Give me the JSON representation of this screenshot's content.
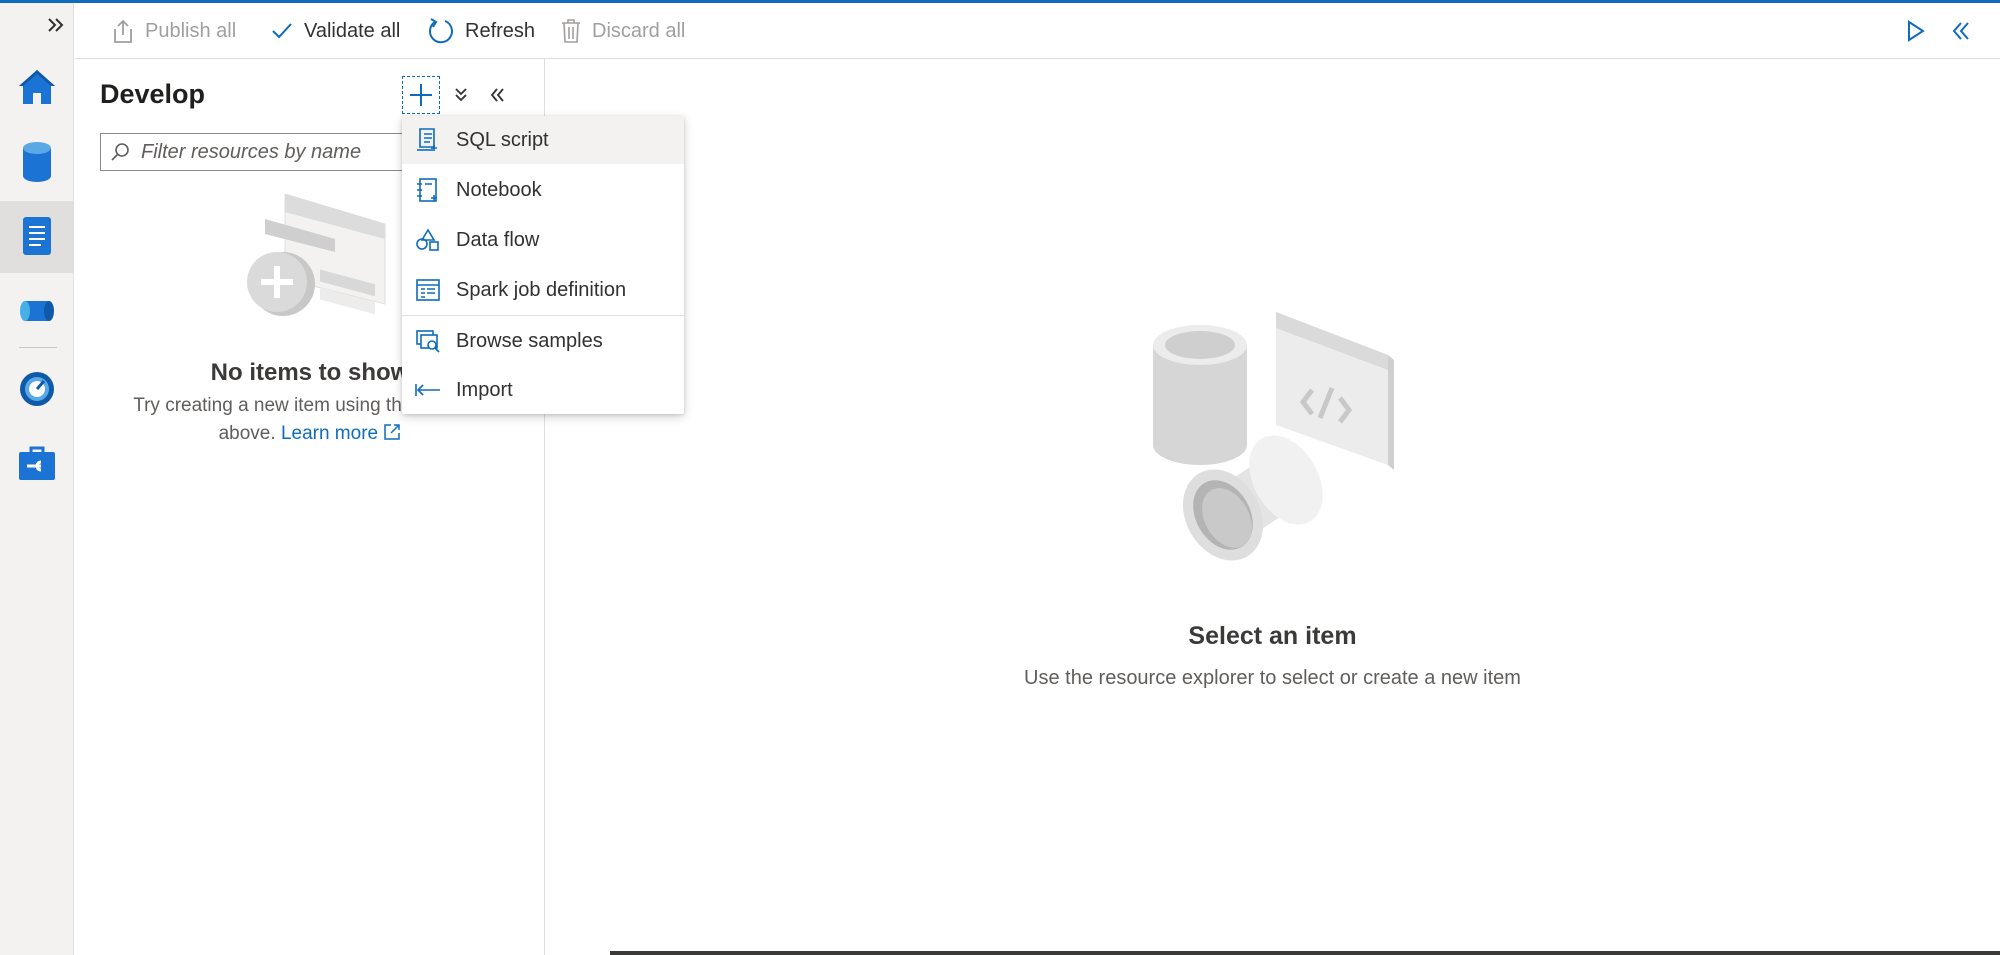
{
  "toolbar": {
    "publish_all": "Publish all",
    "validate_all": "Validate all",
    "refresh": "Refresh",
    "discard_all": "Discard all"
  },
  "rail": {
    "items": [
      {
        "icon": "home-icon"
      },
      {
        "icon": "data-icon"
      },
      {
        "icon": "develop-icon",
        "active": true
      },
      {
        "icon": "integrate-icon"
      },
      {
        "icon": "monitor-icon"
      },
      {
        "icon": "manage-icon"
      }
    ]
  },
  "develop": {
    "title": "Develop",
    "filter_placeholder": "Filter resources by name",
    "empty_title": "No items to show",
    "empty_text": "Try creating a new item using the + button above.",
    "learn_more": "Learn more"
  },
  "menu": {
    "items": [
      {
        "label": "SQL script",
        "icon": "sql-script-icon"
      },
      {
        "label": "Notebook",
        "icon": "notebook-icon"
      },
      {
        "label": "Data flow",
        "icon": "data-flow-icon"
      },
      {
        "label": "Spark job definition",
        "icon": "spark-job-icon"
      },
      {
        "label": "Browse samples",
        "icon": "browse-samples-icon"
      },
      {
        "label": "Import",
        "icon": "import-icon"
      }
    ]
  },
  "main": {
    "title": "Select an item",
    "subtitle": "Use the resource explorer to select or create a new item"
  },
  "colors": {
    "accent": "#0f6cbd",
    "disabled": "#a19f9d"
  }
}
